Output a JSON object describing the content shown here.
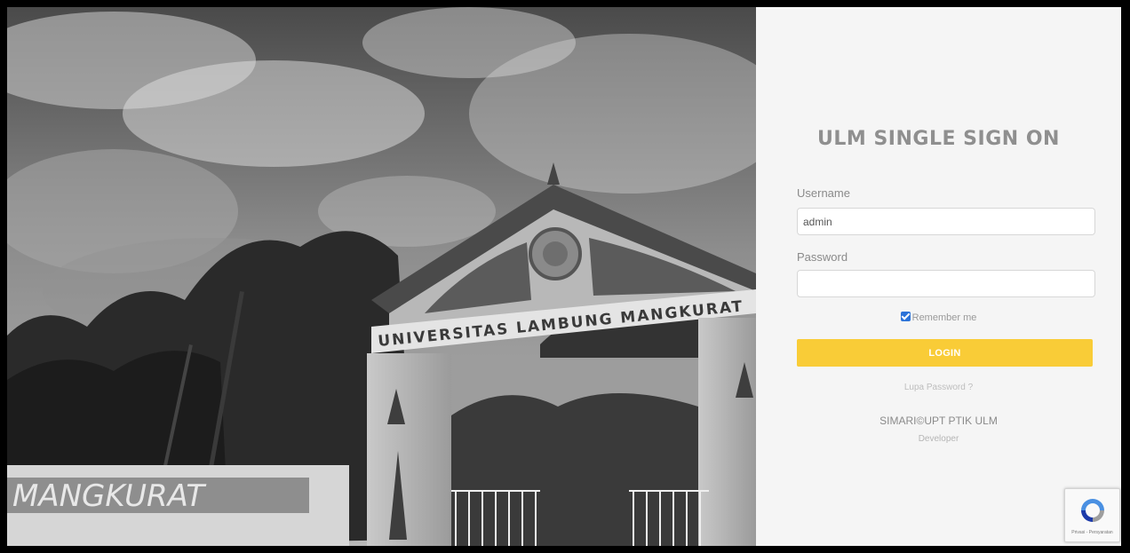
{
  "hero": {
    "image": "campus-gate-photo",
    "gate_sign": "UNIVERSITAS LAMBUNG MANGKURAT",
    "wall_sign": "MANGKURAT"
  },
  "login": {
    "title": "ULM SINGLE SIGN ON",
    "username_label": "Username",
    "username_value": "admin",
    "password_label": "Password",
    "password_value": "",
    "remember_label": "Remember me",
    "remember_checked": true,
    "login_button": "LOGIN",
    "forgot_password": "Lupa Password ?"
  },
  "credits": {
    "name": "SIMARI©UPT PTIK ULM",
    "role": "Developer"
  },
  "recaptcha": {
    "icon": "recaptcha-icon",
    "links": "Privasi - Persyaratan"
  },
  "colors": {
    "accent": "#f9cc37",
    "checkbox": "#2b73d8",
    "panel_bg": "#f5f5f5",
    "title": "#8f8f8f"
  }
}
